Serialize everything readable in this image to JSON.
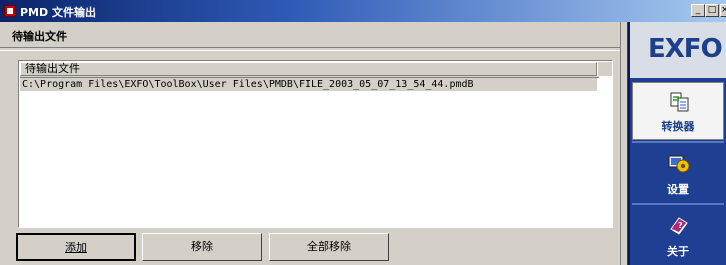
{
  "window": {
    "title": "PMD 文件输出"
  },
  "title_buttons": {
    "minimize": "_",
    "maximize": "□",
    "close": "×"
  },
  "section": {
    "title": "待输出文件"
  },
  "list": {
    "column_header": "待输出文件",
    "rows": [
      "C:\\Program Files\\EXFO\\ToolBox\\User Files\\PMDB\\FILE_2003_05_07_13_54_44.pmdB"
    ]
  },
  "buttons": {
    "add": "添加",
    "remove": "移除",
    "remove_all": "全部移除"
  },
  "sidebar": {
    "logo": "EXFO",
    "items": [
      {
        "label": "转换器",
        "icon": "converter-icon",
        "selected": true
      },
      {
        "label": "设置",
        "icon": "settings-icon",
        "selected": false
      },
      {
        "label": "关于",
        "icon": "about-icon",
        "selected": false
      }
    ]
  }
}
